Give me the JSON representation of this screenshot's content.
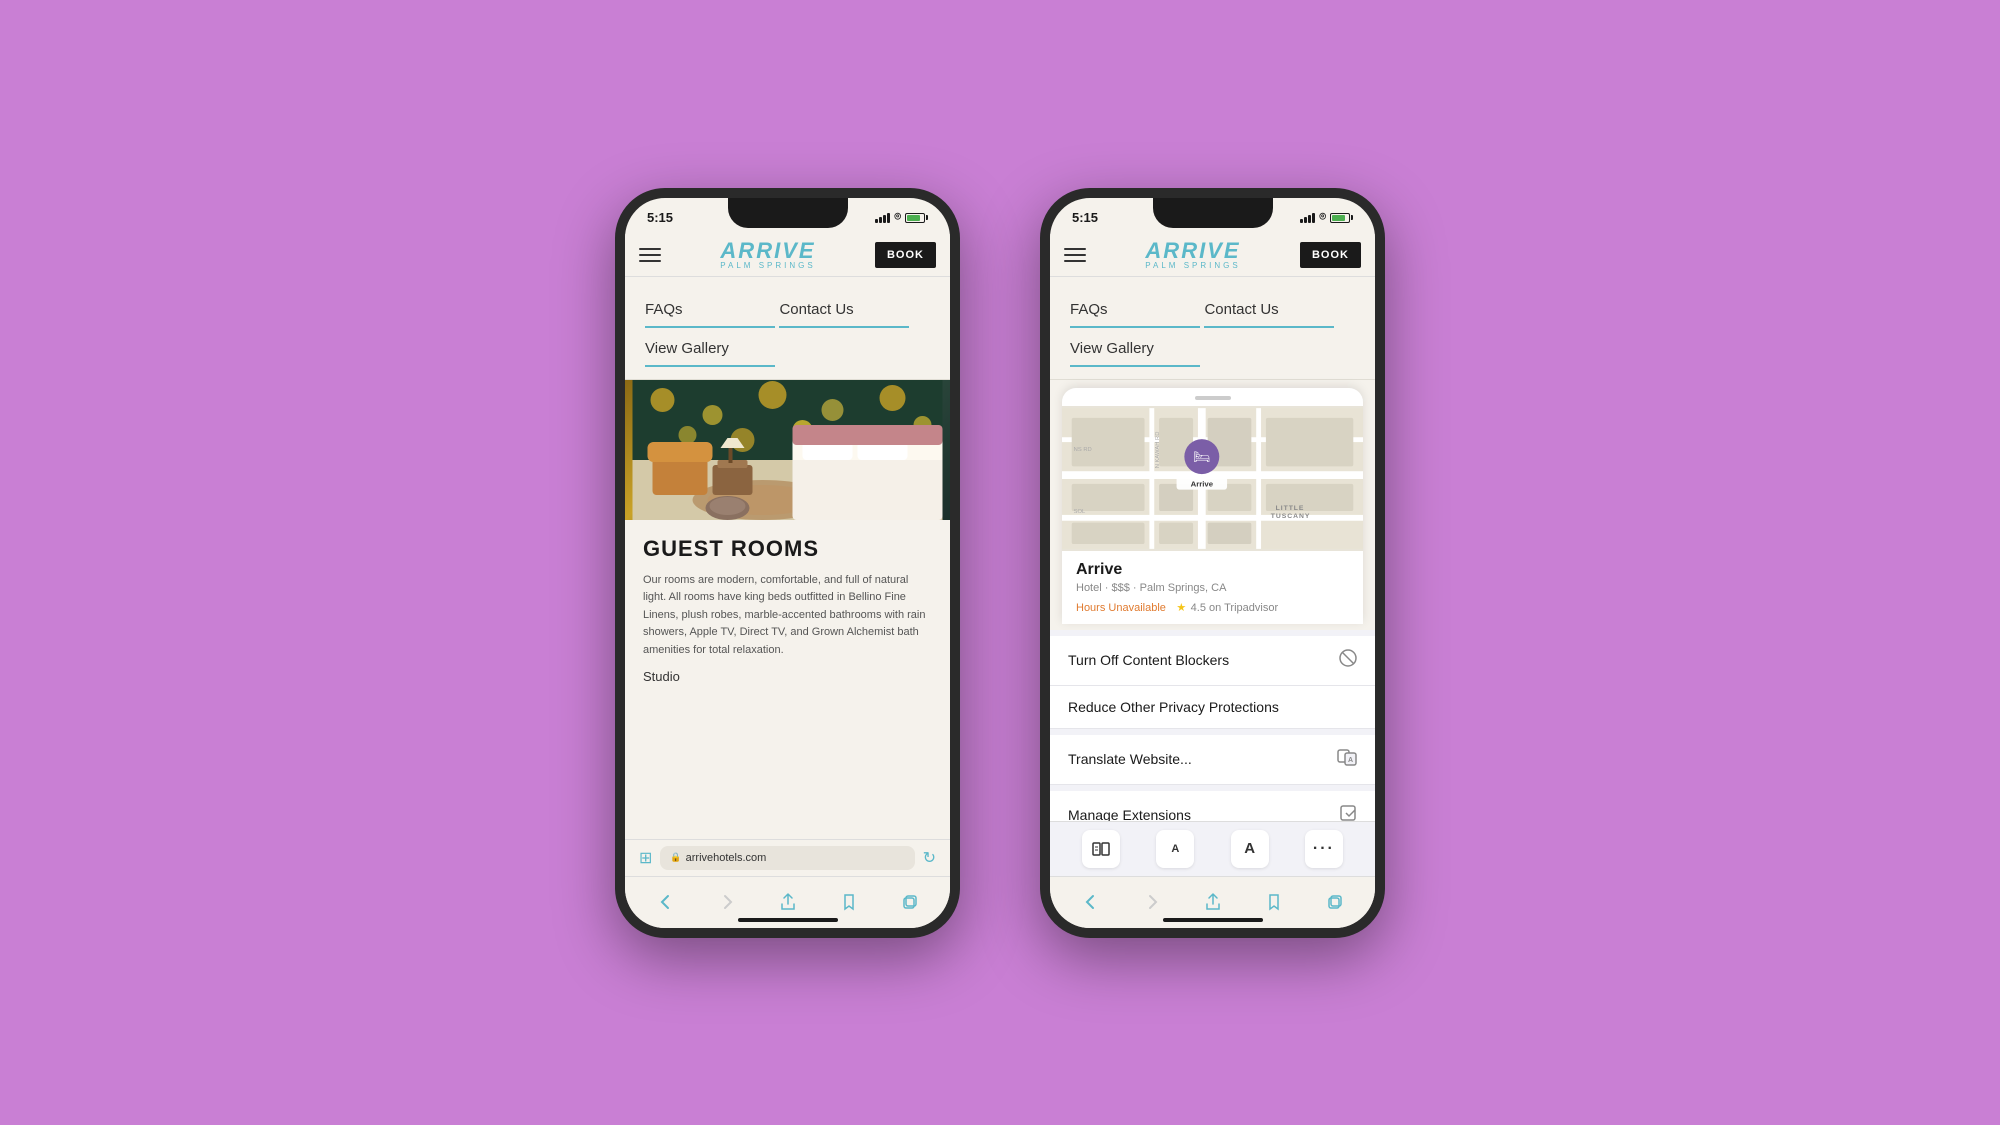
{
  "background_color": "#c97fd4",
  "left_phone": {
    "status_time": "5:15",
    "url": "arrivehotels.com",
    "logo_main": "ARRIVE",
    "logo_sub": "PALM SPRINGS",
    "book_label": "BOOK",
    "nav_items": [
      "FAQs",
      "Contact Us",
      "View Gallery"
    ],
    "room_title": "GUEST ROOMS",
    "room_description": "Our rooms are modern, comfortable, and full of natural light. All rooms have king beds outfitted in Bellino Fine Linens, plush robes, marble-accented bathrooms with rain showers, Apple TV, Direct TV, and Grown Alchemist bath amenities for total relaxation.",
    "room_type": "Studio"
  },
  "right_phone": {
    "status_time": "5:15",
    "logo_main": "ARRIVE",
    "logo_sub": "PALM SPRINGS",
    "book_label": "BOOK",
    "nav_items": [
      "FAQs",
      "Contact Us",
      "View Gallery"
    ],
    "map": {
      "pin_label": "Arrive",
      "area_label": "LITTLE\nTUSCANY",
      "road_label_1": "N INDIAN RD",
      "road_label_2": "NS RD"
    },
    "hotel": {
      "name": "Arrive",
      "type": "Hotel",
      "price": "$$$",
      "location": "Palm Springs, CA",
      "hours_status": "Hours Unavailable",
      "rating": "4.5 on Tripadvisor"
    },
    "menu_items": [
      {
        "label": "Turn Off Content Blockers",
        "icon": "block"
      },
      {
        "label": "Reduce Other Privacy Protections",
        "icon": ""
      },
      {
        "label": "Translate Website...",
        "icon": "translate"
      },
      {
        "label": "Manage Extensions",
        "icon": "extend"
      }
    ],
    "toolbar_items": [
      "reader",
      "A-small",
      "A-large",
      "more"
    ]
  }
}
